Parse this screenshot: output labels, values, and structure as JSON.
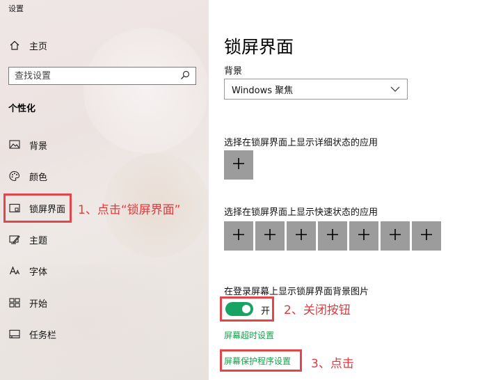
{
  "window": {
    "title": "设置"
  },
  "sidebar": {
    "home_label": "主页",
    "search_placeholder": "查找设置",
    "section_title": "个性化",
    "items": [
      {
        "label": "背景",
        "icon": "picture-icon"
      },
      {
        "label": "颜色",
        "icon": "palette-icon"
      },
      {
        "label": "锁屏界面",
        "icon": "lock-screen-icon"
      },
      {
        "label": "主题",
        "icon": "theme-brush-icon"
      },
      {
        "label": "字体",
        "icon": "font-icon"
      },
      {
        "label": "开始",
        "icon": "start-icon"
      },
      {
        "label": "任务栏",
        "icon": "taskbar-icon"
      }
    ]
  },
  "main": {
    "title": "锁屏界面",
    "background_label": "背景",
    "background_value": "Windows 聚焦",
    "detailed_status_label": "选择在锁屏界面上显示详细状态的应用",
    "quick_status_label": "选择在锁屏界面上显示快速状态的应用",
    "plus_symbol": "+",
    "signin_bg_label": "在登录屏幕上显示锁屏界面背景图片",
    "toggle_state": "开",
    "screen_timeout_link": "屏幕超时设置",
    "screensaver_link": "屏幕保护程序设置"
  },
  "annotations": {
    "step1": "1、点击“锁屏界面”",
    "step2": "2、关闭按钮",
    "step3": "3、点击"
  },
  "colors": {
    "accent_green": "#17a463",
    "annotation_red": "#e03a3e",
    "button_gray": "#9c9c9c"
  }
}
